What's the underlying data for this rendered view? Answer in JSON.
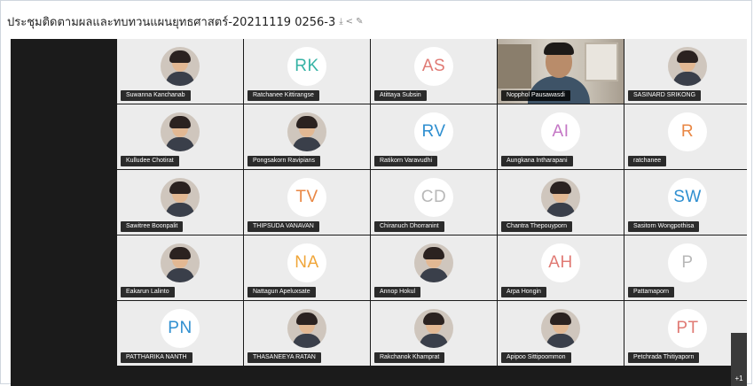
{
  "window": {
    "title": "ประชุมติดตามผลและทบทวนแผนยุทธศาสตร์-20211119 0256-3",
    "icons": [
      "download-icon",
      "share-icon",
      "edit-icon"
    ]
  },
  "participants": [
    {
      "name": "Suwanna Kanchanab",
      "type": "photo"
    },
    {
      "name": "Ratchanee Kittirangse",
      "type": "initials",
      "initials": "RK",
      "color": "#36b3a5"
    },
    {
      "name": "Atittaya Subsin",
      "type": "initials",
      "initials": "AS",
      "color": "#e07a74"
    },
    {
      "name": "Nopphol Pausawasdi",
      "type": "video"
    },
    {
      "name": "SASINARD SRIKONG",
      "type": "photo"
    },
    {
      "name": "Kulludee Chotirat",
      "type": "photo"
    },
    {
      "name": "Pongsakorn Ravipians",
      "type": "photo"
    },
    {
      "name": "Ratikorn Varavudhi",
      "type": "initials",
      "initials": "RV",
      "color": "#2f8fd0"
    },
    {
      "name": "Aungkana Intharapani",
      "type": "initials",
      "initials": "AI",
      "color": "#c476c5"
    },
    {
      "name": "ratchanee",
      "type": "initials",
      "initials": "R",
      "color": "#e98744"
    },
    {
      "name": "Sawitree Boonpalit",
      "type": "photo"
    },
    {
      "name": "THIPSUDA VANAVAN",
      "type": "initials",
      "initials": "TV",
      "color": "#e98744"
    },
    {
      "name": "Chiranuch Dhorranint",
      "type": "initials",
      "initials": "CD",
      "color": "#b8b8b8"
    },
    {
      "name": "Chantra Thepouyporn",
      "type": "photo"
    },
    {
      "name": "Sasitorn Wongpothisa",
      "type": "initials",
      "initials": "SW",
      "color": "#2f8fd0"
    },
    {
      "name": "Eakarun Lalinto",
      "type": "photo"
    },
    {
      "name": "Nattagun Apeluxsate",
      "type": "initials",
      "initials": "NA",
      "color": "#f0a63a"
    },
    {
      "name": "Annop Hokul",
      "type": "photo"
    },
    {
      "name": "Arpa Hongin",
      "type": "initials",
      "initials": "AH",
      "color": "#e07a74"
    },
    {
      "name": "Pattamaporn",
      "type": "initials",
      "initials": "P",
      "color": "#b8b8b8"
    },
    {
      "name": "PATTHARIKA NANTH",
      "type": "initials",
      "initials": "PN",
      "color": "#2f8fd0"
    },
    {
      "name": "THASANEEYA RATAN",
      "type": "photo"
    },
    {
      "name": "Rakchanok Khamprat",
      "type": "photo"
    },
    {
      "name": "Apipoo Sittipoommon",
      "type": "photo"
    },
    {
      "name": "Petchrada Thitiyaporn",
      "type": "initials",
      "initials": "PT",
      "color": "#e07a74"
    }
  ],
  "overflow_count": "+1"
}
